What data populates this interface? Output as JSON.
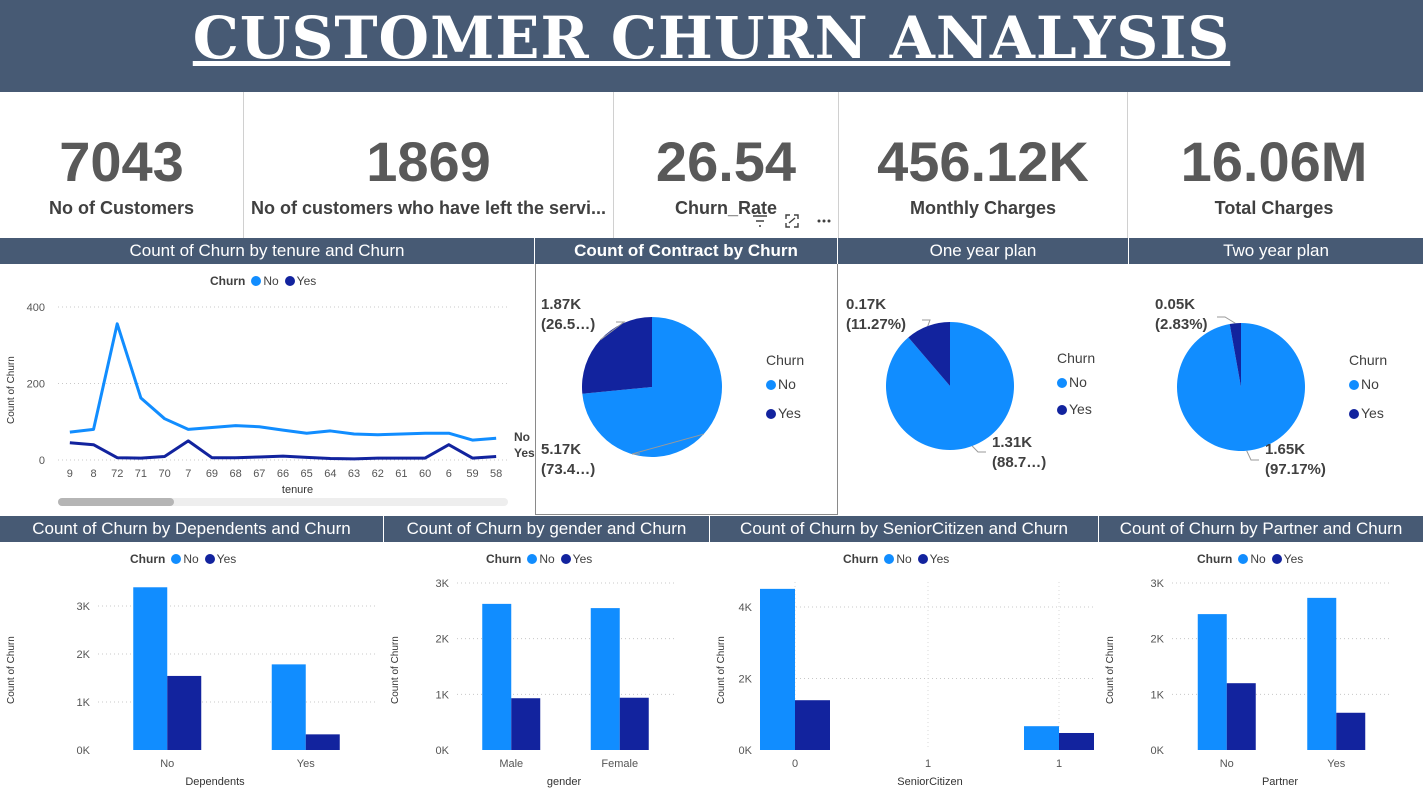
{
  "header": {
    "title": "CUSTOMER CHURN ANALYSIS"
  },
  "kpis": [
    {
      "value": "7043",
      "label": "No of Customers"
    },
    {
      "value": "1869",
      "label": "No of customers who have left the servi..."
    },
    {
      "value": "26.54",
      "label": "Churn_Rate"
    },
    {
      "value": "456.12K",
      "label": "Monthly Charges"
    },
    {
      "value": "16.06M",
      "label": "Total Charges"
    }
  ],
  "colors": {
    "no": "#118dff",
    "yes": "#12239e",
    "header": "#475a74"
  },
  "icons": [
    "filter-icon",
    "focus-mode-icon",
    "more-options-icon"
  ],
  "legend": {
    "title": "Churn",
    "no": "No",
    "yes": "Yes"
  },
  "tenure_chart": {
    "title": "Count of Churn by tenure and Churn",
    "ylabel": "Count of Churn",
    "xlabel": "tenure",
    "end_label_no": "No",
    "end_label_yes": "Yes",
    "chart_data": {
      "type": "line",
      "categories": [
        "9",
        "8",
        "72",
        "71",
        "70",
        "7",
        "69",
        "68",
        "67",
        "66",
        "65",
        "64",
        "63",
        "62",
        "61",
        "60",
        "6",
        "59",
        "58"
      ],
      "ylim": [
        0,
        400
      ],
      "yticks": [
        "0",
        "200",
        "400"
      ],
      "series": [
        {
          "name": "No",
          "values": [
            73,
            80,
            356,
            162,
            108,
            80,
            85,
            90,
            87,
            78,
            70,
            76,
            68,
            66,
            68,
            70,
            70,
            52,
            57
          ]
        },
        {
          "name": "Yes",
          "values": [
            45,
            40,
            6,
            5,
            9,
            50,
            6,
            6,
            8,
            10,
            7,
            4,
            3,
            5,
            5,
            5,
            40,
            5,
            9
          ]
        }
      ]
    }
  },
  "contract_chart": {
    "title": "Count of Contract by Churn",
    "label_yes_value": "1.87K",
    "label_yes_pct": "(26.5…)",
    "label_no_value": "5.17K",
    "label_no_pct": "(73.4…)",
    "chart_data": {
      "type": "pie",
      "labels": [
        "No",
        "Yes"
      ],
      "values": [
        5174,
        1869
      ]
    }
  },
  "one_year_chart": {
    "title": "One year plan",
    "label_yes_value": "0.17K",
    "label_yes_pct": "(11.27%)",
    "label_no_value": "1.31K",
    "label_no_pct": "(88.7…)",
    "chart_data": {
      "type": "pie",
      "labels": [
        "No",
        "Yes"
      ],
      "values": [
        1307,
        166
      ]
    }
  },
  "two_year_chart": {
    "title": "Two year plan",
    "label_yes_value": "0.05K",
    "label_yes_pct": "(2.83%)",
    "label_no_value": "1.65K",
    "label_no_pct": "(97.17%)",
    "chart_data": {
      "type": "pie",
      "labels": [
        "No",
        "Yes"
      ],
      "values": [
        1647,
        48
      ]
    }
  },
  "dependents_chart": {
    "title": "Count of Churn by Dependents and Churn",
    "ylabel": "Count of Churn",
    "xlabel": "Dependents",
    "chart_data": {
      "type": "bar",
      "categories": [
        "No",
        "Yes"
      ],
      "ylim": [
        0,
        3500
      ],
      "yticks": [
        "0K",
        "1K",
        "2K",
        "3K"
      ],
      "series": [
        {
          "name": "No",
          "values": [
            3390,
            1784
          ]
        },
        {
          "name": "Yes",
          "values": [
            1543,
            326
          ]
        }
      ]
    }
  },
  "gender_chart": {
    "title": "Count of Churn by gender and Churn",
    "ylabel": "Count of Churn",
    "xlabel": "gender",
    "chart_data": {
      "type": "bar",
      "categories": [
        "Male",
        "Female"
      ],
      "ylim": [
        0,
        3000
      ],
      "yticks": [
        "0K",
        "1K",
        "2K",
        "3K"
      ],
      "series": [
        {
          "name": "No",
          "values": [
            2625,
            2549
          ]
        },
        {
          "name": "Yes",
          "values": [
            930,
            939
          ]
        }
      ]
    }
  },
  "senior_chart": {
    "title": "Count of Churn by SeniorCitizen and Churn",
    "ylabel": "Count of Churn",
    "xlabel": "SeniorCitizen",
    "chart_data": {
      "type": "bar",
      "categories": [
        "0",
        "1"
      ],
      "x_ticks": [
        "0",
        "1",
        "1"
      ],
      "ylim": [
        0,
        4700
      ],
      "yticks": [
        "0K",
        "2K",
        "4K"
      ],
      "series": [
        {
          "name": "No",
          "values": [
            4508,
            666
          ]
        },
        {
          "name": "Yes",
          "values": [
            1393,
            476
          ]
        }
      ]
    }
  },
  "partner_chart": {
    "title": "Count of Churn by Partner and Churn",
    "ylabel": "Count of Churn",
    "xlabel": "Partner",
    "chart_data": {
      "type": "bar",
      "categories": [
        "No",
        "Yes"
      ],
      "ylim": [
        0,
        3000
      ],
      "yticks": [
        "0K",
        "1K",
        "2K",
        "3K"
      ],
      "series": [
        {
          "name": "No",
          "values": [
            2441,
            2733
          ]
        },
        {
          "name": "Yes",
          "values": [
            1200,
            669
          ]
        }
      ]
    }
  }
}
